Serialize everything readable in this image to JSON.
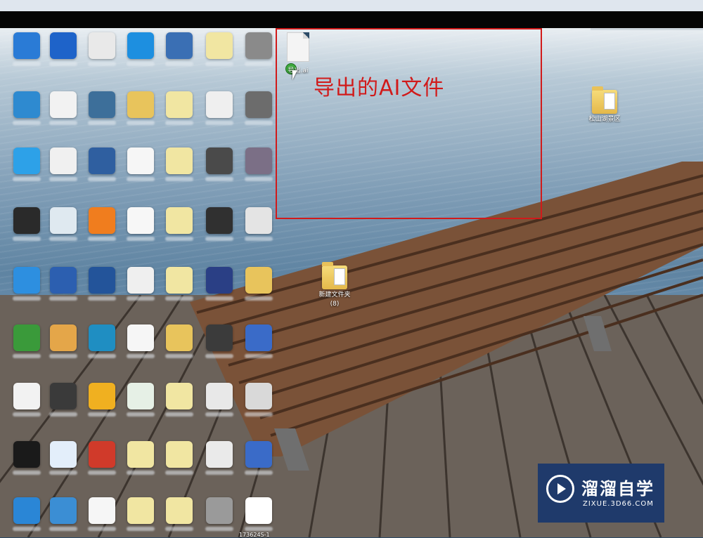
{
  "annotation": {
    "caption": "导出的AI文件",
    "color": "#d11a1a"
  },
  "exported_file": {
    "label": "导出.ai"
  },
  "folders": [
    {
      "label": "松山湖景区",
      "sub": ""
    },
    {
      "label": "新建文件夹",
      "sub": "(8)"
    }
  ],
  "desktop_icons": [
    {
      "col": 0,
      "row": 0,
      "icon": "app-icon",
      "color": "#2a7bd6"
    },
    {
      "col": 1,
      "row": 0,
      "icon": "app-icon",
      "color": "#1e63c9"
    },
    {
      "col": 2,
      "row": 0,
      "icon": "document-icon",
      "color": "#e9e9e9"
    },
    {
      "col": 3,
      "row": 0,
      "icon": "media-icon",
      "color": "#1d8fe0"
    },
    {
      "col": 4,
      "row": 0,
      "icon": "monitor-icon",
      "color": "#3a6fb4"
    },
    {
      "col": 5,
      "row": 0,
      "icon": "image-icon",
      "color": "#f1e6a2"
    },
    {
      "col": 6,
      "row": 0,
      "icon": "image-icon",
      "color": "#8a8a8a"
    },
    {
      "col": 0,
      "row": 1,
      "icon": "app-icon",
      "color": "#2e8ad0"
    },
    {
      "col": 1,
      "row": 1,
      "icon": "document-icon",
      "color": "#f2f2f2"
    },
    {
      "col": 2,
      "row": 1,
      "icon": "app-icon",
      "color": "#3d6f9a"
    },
    {
      "col": 3,
      "row": 1,
      "icon": "folder-icon",
      "color": "#e8c45c"
    },
    {
      "col": 4,
      "row": 1,
      "icon": "image-icon",
      "color": "#f1e6a2"
    },
    {
      "col": 5,
      "row": 1,
      "icon": "image-icon",
      "color": "#efefef"
    },
    {
      "col": 6,
      "row": 1,
      "icon": "image-icon",
      "color": "#6c6c6c"
    },
    {
      "col": 0,
      "row": 2,
      "icon": "app-icon",
      "color": "#2da1e8"
    },
    {
      "col": 1,
      "row": 2,
      "icon": "document-icon",
      "color": "#f0f0f0"
    },
    {
      "col": 2,
      "row": 2,
      "icon": "app-icon",
      "color": "#2f5fa0"
    },
    {
      "col": 3,
      "row": 2,
      "icon": "image-icon",
      "color": "#f6f6f6"
    },
    {
      "col": 4,
      "row": 2,
      "icon": "image-icon",
      "color": "#f1e6a2"
    },
    {
      "col": 5,
      "row": 2,
      "icon": "image-icon",
      "color": "#4a4a4a"
    },
    {
      "col": 6,
      "row": 2,
      "icon": "image-icon",
      "color": "#7b6f86"
    },
    {
      "col": 0,
      "row": 3,
      "icon": "app-icon",
      "color": "#2a2a2a"
    },
    {
      "col": 1,
      "row": 3,
      "icon": "document-icon",
      "color": "#dfe9f0"
    },
    {
      "col": 2,
      "row": 3,
      "icon": "browser-icon",
      "color": "#f07d1e"
    },
    {
      "col": 3,
      "row": 3,
      "icon": "document-icon",
      "color": "#f7f7f7"
    },
    {
      "col": 4,
      "row": 3,
      "icon": "image-icon",
      "color": "#f1e6a2"
    },
    {
      "col": 5,
      "row": 3,
      "icon": "image-icon",
      "color": "#303030"
    },
    {
      "col": 6,
      "row": 3,
      "icon": "image-icon",
      "color": "#e4e4e4"
    },
    {
      "col": 0,
      "row": 4,
      "icon": "app-icon",
      "color": "#2d8fe0"
    },
    {
      "col": 1,
      "row": 4,
      "icon": "monitor-icon",
      "color": "#2c5fb0"
    },
    {
      "col": 2,
      "row": 4,
      "icon": "app-icon",
      "color": "#23549a"
    },
    {
      "col": 3,
      "row": 4,
      "icon": "image-icon",
      "color": "#efefef"
    },
    {
      "col": 4,
      "row": 4,
      "icon": "image-icon",
      "color": "#f1e6a2"
    },
    {
      "col": 5,
      "row": 4,
      "icon": "image-icon",
      "color": "#2a3f85"
    },
    {
      "col": 6,
      "row": 4,
      "icon": "folder-icon",
      "color": "#e8c45c"
    },
    {
      "col": 0,
      "row": 5,
      "icon": "app-icon",
      "color": "#3a9a3a"
    },
    {
      "col": 1,
      "row": 5,
      "icon": "mail-icon",
      "color": "#e4a649"
    },
    {
      "col": 2,
      "row": 5,
      "icon": "app-icon",
      "color": "#1f8ec2"
    },
    {
      "col": 3,
      "row": 5,
      "icon": "image-icon",
      "color": "#f6f6f6"
    },
    {
      "col": 4,
      "row": 5,
      "icon": "folder-icon",
      "color": "#e8c45c"
    },
    {
      "col": 5,
      "row": 5,
      "icon": "image-icon",
      "color": "#3b3b3b"
    },
    {
      "col": 6,
      "row": 5,
      "icon": "archive-icon",
      "color": "#3a6bc8"
    },
    {
      "col": 0,
      "row": 6,
      "icon": "document-icon",
      "color": "#f2f2f2"
    },
    {
      "col": 1,
      "row": 6,
      "icon": "app-icon",
      "color": "#3a3a3a"
    },
    {
      "col": 2,
      "row": 6,
      "icon": "app-icon",
      "color": "#f0b020"
    },
    {
      "col": 3,
      "row": 6,
      "icon": "document-icon",
      "color": "#e6f0e6"
    },
    {
      "col": 4,
      "row": 6,
      "icon": "image-icon",
      "color": "#f1e6a2"
    },
    {
      "col": 5,
      "row": 6,
      "icon": "image-icon",
      "color": "#e8e8e8"
    },
    {
      "col": 6,
      "row": 6,
      "icon": "image-icon",
      "color": "#d9d9d9"
    },
    {
      "col": 0,
      "row": 7,
      "icon": "qq-icon",
      "color": "#1a1a1a"
    },
    {
      "col": 1,
      "row": 7,
      "icon": "document-icon",
      "color": "#e3eefa"
    },
    {
      "col": 2,
      "row": 7,
      "icon": "app-icon",
      "color": "#d03a2a"
    },
    {
      "col": 3,
      "row": 7,
      "icon": "image-icon",
      "color": "#f1e6a2"
    },
    {
      "col": 4,
      "row": 7,
      "icon": "image-icon",
      "color": "#f1e6a2"
    },
    {
      "col": 5,
      "row": 7,
      "icon": "image-icon",
      "color": "#eaeaea"
    },
    {
      "col": 6,
      "row": 7,
      "icon": "archive-icon",
      "color": "#3a6bc8"
    },
    {
      "col": 0,
      "row": 8,
      "icon": "app-icon",
      "color": "#2a86d6"
    },
    {
      "col": 1,
      "row": 8,
      "icon": "app-icon",
      "color": "#3b8ed4"
    },
    {
      "col": 2,
      "row": 8,
      "icon": "image-icon",
      "color": "#f6f6f6"
    },
    {
      "col": 3,
      "row": 8,
      "icon": "image-icon",
      "color": "#f1e6a2"
    },
    {
      "col": 4,
      "row": 8,
      "icon": "image-icon",
      "color": "#f1e6a2"
    },
    {
      "col": 5,
      "row": 8,
      "icon": "image-icon",
      "color": "#9a9a9a"
    },
    {
      "col": 6,
      "row": 8,
      "icon": "image-icon",
      "color": "#ffffff"
    }
  ],
  "last_icon_label": "173624S-1",
  "watermark": {
    "title": "溜溜自学",
    "url": "ZIXUE.3D66.COM"
  }
}
